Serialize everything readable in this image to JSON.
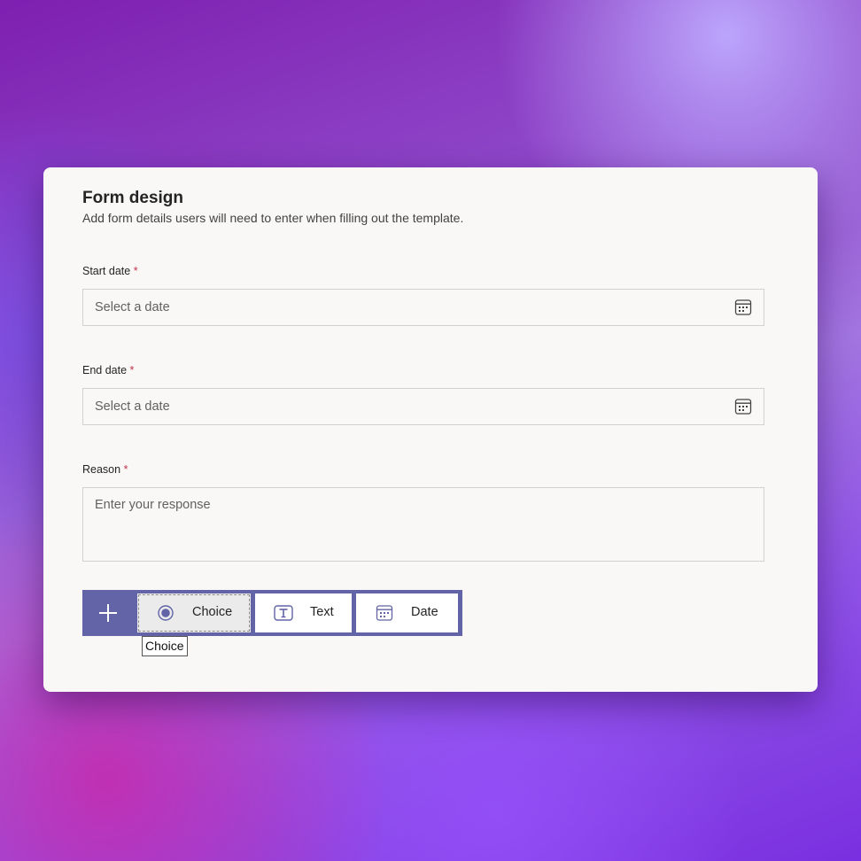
{
  "form": {
    "title": "Form design",
    "subtitle": "Add form details users will need to enter when filling out the template.",
    "required_marker": "*",
    "start_date": {
      "label": "Start date",
      "placeholder": "Select a date",
      "icon": "calendar-icon"
    },
    "end_date": {
      "label": "End date",
      "placeholder": "Select a date",
      "icon": "calendar-icon"
    },
    "reason": {
      "label": "Reason",
      "placeholder": "Enter your response"
    }
  },
  "toolbar": {
    "add_icon": "plus-icon",
    "buttons": [
      {
        "label": "Choice",
        "icon": "radio-icon",
        "state": "hovered"
      },
      {
        "label": "Text",
        "icon": "text-box-icon"
      },
      {
        "label": "Date",
        "icon": "calendar-icon"
      }
    ],
    "tooltip": "Choice"
  },
  "colors": {
    "accent": "#6264a7",
    "required": "#c4314b",
    "card_bg": "#f9f8f7",
    "field_border": "#d1d1d1"
  }
}
